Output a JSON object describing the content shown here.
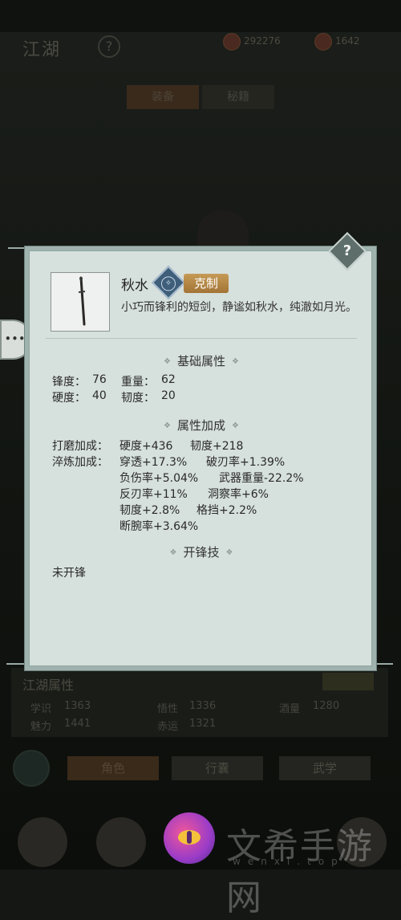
{
  "background": {
    "title": "江湖",
    "help": "?",
    "currency": [
      {
        "icon": "coin-icon",
        "value": "292276"
      },
      {
        "icon": "ingot-icon",
        "value": "1642"
      }
    ],
    "tabs": [
      "装备",
      "秘籍"
    ],
    "attributes": {
      "title": "江湖属性",
      "stats": [
        {
          "label": "学识",
          "value": "1363"
        },
        {
          "label": "悟性",
          "value": "1336"
        },
        {
          "label": "酒量",
          "value": "1280"
        },
        {
          "label": "魅力",
          "value": "1441"
        },
        {
          "label": "赤运",
          "value": "1321"
        }
      ]
    },
    "bottom_buttons": [
      "角色",
      "行囊",
      "武学"
    ]
  },
  "tooltip": {
    "help_icon": "?",
    "item_name": "秋水",
    "badge_label": "克制",
    "description": "小巧而锋利的短剑，静谧如秋水，纯澈如月光。",
    "base_title": "基础属性",
    "base_stats": [
      [
        {
          "label": "锋度：",
          "value": "76"
        },
        {
          "label": "重量：",
          "value": "62"
        }
      ],
      [
        {
          "label": "硬度：",
          "value": "40"
        },
        {
          "label": "韧度：",
          "value": "20"
        }
      ]
    ],
    "bonus_title": "属性加成",
    "polish_label": "打磨加成：",
    "polish_bonus": [
      "硬度+436",
      "韧度+218"
    ],
    "temper_label": "淬炼加成：",
    "temper_bonus": [
      [
        "穿透+17.3%",
        "破刃率+1.39%"
      ],
      [
        "负伤率+5.04%",
        "武器重量-22.2%"
      ],
      [
        "反刃率+11%",
        "洞察率+6%"
      ],
      [
        "韧度+2.8%",
        "格挡+2.2%"
      ],
      [
        "断腕率+3.64%"
      ]
    ],
    "skill_title": "开锋技",
    "skill_value": "未开锋"
  },
  "watermark": {
    "text": "文希手游网",
    "sub": "wenxi.top"
  },
  "colors": {
    "card_bg": "#d6e0dd",
    "badge": "#b3854a",
    "overlay": "#141713"
  }
}
